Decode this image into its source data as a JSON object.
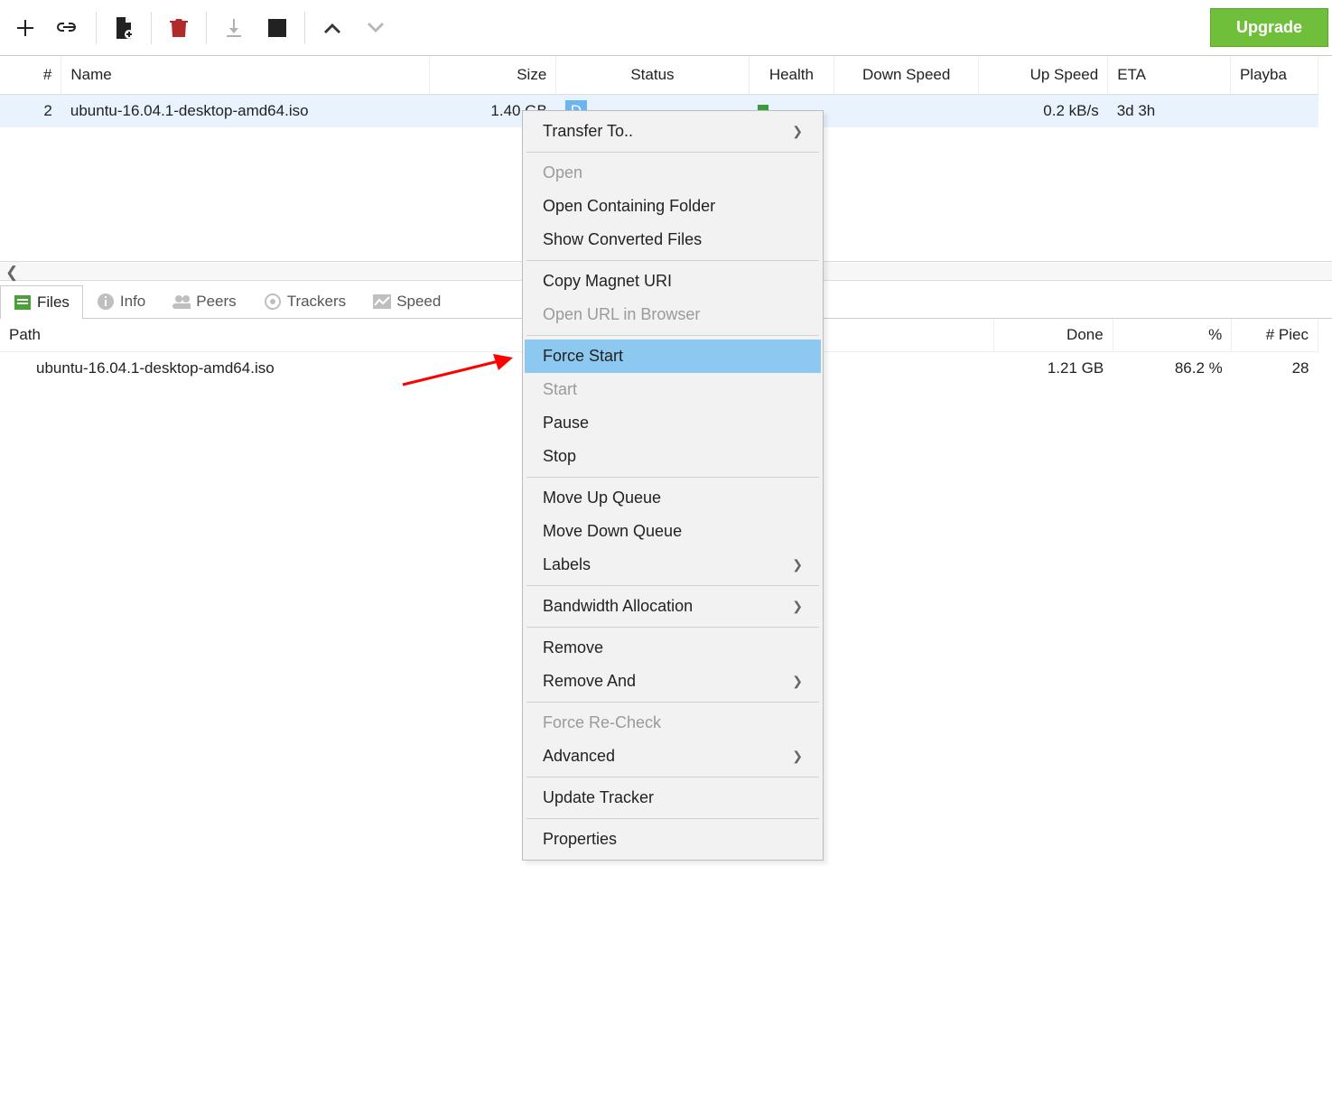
{
  "toolbar": {
    "upgrade_label": "Upgrade"
  },
  "columns": {
    "num": "#",
    "name": "Name",
    "size": "Size",
    "status": "Status",
    "health": "Health",
    "down": "Down Speed",
    "up": "Up Speed",
    "eta": "ETA",
    "playba": "Playba"
  },
  "torrents": [
    {
      "num": "2",
      "name": "ubuntu-16.04.1-desktop-amd64.iso",
      "size": "1.40 GB",
      "status_prefix": "D",
      "up": "0.2 kB/s",
      "eta": "3d 3h"
    }
  ],
  "detail_tabs": {
    "files": "Files",
    "info": "Info",
    "peers": "Peers",
    "trackers": "Trackers",
    "speed": "Speed"
  },
  "file_columns": {
    "path": "Path",
    "done": "Done",
    "pct": "%",
    "pieces": "# Piec"
  },
  "files": [
    {
      "path": "ubuntu-16.04.1-desktop-amd64.iso",
      "done": "1.21 GB",
      "pct": "86.2 %",
      "pieces": "28"
    }
  ],
  "ctx": {
    "transfer_to": "Transfer To..",
    "open": "Open",
    "open_folder": "Open Containing Folder",
    "show_converted": "Show Converted Files",
    "copy_magnet": "Copy Magnet URI",
    "open_url": "Open URL in Browser",
    "force_start": "Force Start",
    "start": "Start",
    "pause": "Pause",
    "stop": "Stop",
    "move_up": "Move Up Queue",
    "move_down": "Move Down Queue",
    "labels": "Labels",
    "bandwidth": "Bandwidth Allocation",
    "remove": "Remove",
    "remove_and": "Remove And",
    "force_recheck": "Force Re-Check",
    "advanced": "Advanced",
    "update_tracker": "Update Tracker",
    "properties": "Properties"
  }
}
